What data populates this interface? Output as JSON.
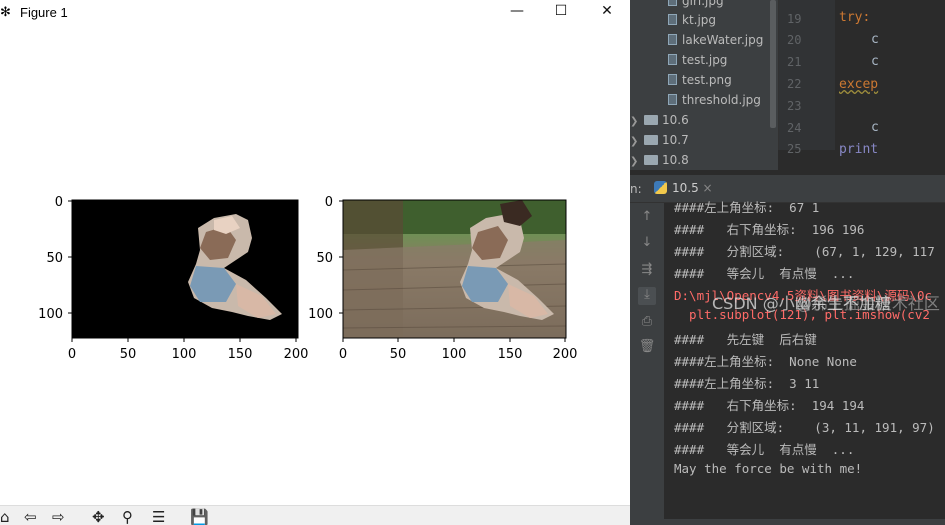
{
  "figure_window": {
    "title": "Figure 1",
    "min_glyph": "—",
    "max_glyph": "☐",
    "close_glyph": "✕",
    "toolbar_icons": [
      "home-icon",
      "back-icon",
      "forward-icon",
      "pan-icon",
      "zoom-icon",
      "subplots-icon",
      "save-icon"
    ],
    "toolbar_glyphs": [
      "⌂",
      "⇦",
      "⇨",
      "✥",
      "⚲",
      "☰",
      "💾"
    ]
  },
  "chart_data": [
    {
      "type": "image",
      "description_id": "left-subplot",
      "xticks": [
        "0",
        "50",
        "100",
        "150",
        "200"
      ],
      "yticks": [
        "0",
        "50",
        "100"
      ],
      "xlim": [
        0,
        200
      ],
      "ylim": [
        120,
        0
      ]
    },
    {
      "type": "image",
      "description_id": "right-subplot",
      "xticks": [
        "0",
        "50",
        "100",
        "150",
        "200"
      ],
      "yticks": [
        "0",
        "50",
        "100"
      ],
      "xlim": [
        0,
        200
      ],
      "ylim": [
        120,
        0
      ]
    }
  ],
  "project_tree": {
    "files": [
      "girl.jpg",
      "kt.jpg",
      "lakeWater.jpg",
      "test.jpg",
      "test.png",
      "threshold.jpg"
    ],
    "folders": [
      "10.6",
      "10.7",
      "10.8"
    ]
  },
  "editor": {
    "line_numbers": [
      "19",
      "20",
      "21",
      "22",
      "23",
      "24",
      "25"
    ],
    "try_kw": "try:",
    "except_kw": "excep",
    "print_kw": "print",
    "c1": "c",
    "c2": "c",
    "c3": "c"
  },
  "run_panel": {
    "label": "n:",
    "tab": "10.5",
    "close_glyph": "×"
  },
  "console_lines": [
    {
      "text": "####左上角坐标:  67 1",
      "error": false
    },
    {
      "text": "####   右下角坐标:  196 196",
      "error": false
    },
    {
      "text": "####   分割区域:    (67, 1, 129, 117",
      "error": false
    },
    {
      "text": "####   等会儿  有点慢  ...",
      "error": false
    },
    {
      "text": "D:\\mjl\\Opencv4.5资料\\图书资料\\源码\\0c",
      "error": true
    },
    {
      "text": "  plt.subplot(121), plt.imshow(cv2",
      "error": true
    },
    {
      "text": "####   先左键  后右键",
      "error": false
    },
    {
      "text": "####左上角坐标:  None None",
      "error": false
    },
    {
      "text": "####左上角坐标:  3 11",
      "error": false
    },
    {
      "text": "####   右下角坐标:  194 194",
      "error": false
    },
    {
      "text": "####   分割区域:    (3, 11, 191, 97)",
      "error": false
    },
    {
      "text": "####   等会儿  有点慢  ...",
      "error": false
    },
    {
      "text": "May the force be with me!",
      "error": false
    }
  ],
  "watermark": "CSDN @小幽余生不加糖",
  "watermark2": "@稀土掘金技术社区",
  "colors": {
    "console_text": "#bbbbbb",
    "error_text": "#ff6b68",
    "ide_bg": "#2b2b2b"
  }
}
